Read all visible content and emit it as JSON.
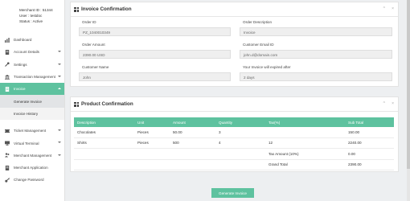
{
  "merchant": {
    "id_line": "Merchant ID : 51344",
    "user_line": "User : testdoc",
    "status_line": "Status : Active"
  },
  "sidebar": {
    "items": [
      {
        "label": "Dashboard",
        "icon": "bar-chart-icon"
      },
      {
        "label": "Account Details",
        "icon": "document-icon"
      },
      {
        "label": "Settings",
        "icon": "wrench-icon"
      },
      {
        "label": "Transaction Management",
        "icon": "bank-icon"
      },
      {
        "label": "Invoice",
        "icon": "invoice-icon"
      },
      {
        "label": "Ticket Management",
        "icon": "ticket-icon"
      },
      {
        "label": "Virtual Terminal",
        "icon": "monitor-icon"
      },
      {
        "label": "Merchant Management",
        "icon": "users-icon"
      },
      {
        "label": "Merchant Application",
        "icon": "document-icon"
      },
      {
        "label": "Change Password",
        "icon": "key-icon"
      }
    ],
    "sub_items": [
      {
        "label": "Generate Invoice"
      },
      {
        "label": "Invoice History"
      }
    ]
  },
  "invoice_confirmation": {
    "title": "Invoice Confirmation",
    "order_id_label": "Order ID",
    "order_id_value": "PZ_1040010349",
    "order_desc_label": "Order Description",
    "order_desc_value": "Invoice",
    "order_amount_label": "Order Amount",
    "order_amount_value": "2390.00  USD",
    "customer_email_label": "Customer Email ID",
    "customer_email_value": "john.d@domain.com",
    "customer_name_label": "Customer Name",
    "customer_name_value": "John",
    "expiry_label": "Your Invoice will expired after",
    "expiry_value": "2 days"
  },
  "product_confirmation": {
    "title": "Product Confirmation",
    "columns": [
      "Description",
      "Unit",
      "Amount",
      "Quantity",
      "Tax(%)",
      "Sub Total"
    ],
    "rows": [
      [
        "Chocolates",
        "Pieces",
        "50.00",
        "3",
        "",
        "150.00"
      ],
      [
        "Shirts",
        "Pieces",
        "500",
        "4",
        "12",
        "2240.00"
      ]
    ],
    "tax_label": "Tax Amount (10%)",
    "tax_value": "0.00",
    "grand_label": "Grand Total",
    "grand_value": "2390.00"
  },
  "generate_button": "Generate Invoice",
  "accent_color": "#5ec29f"
}
